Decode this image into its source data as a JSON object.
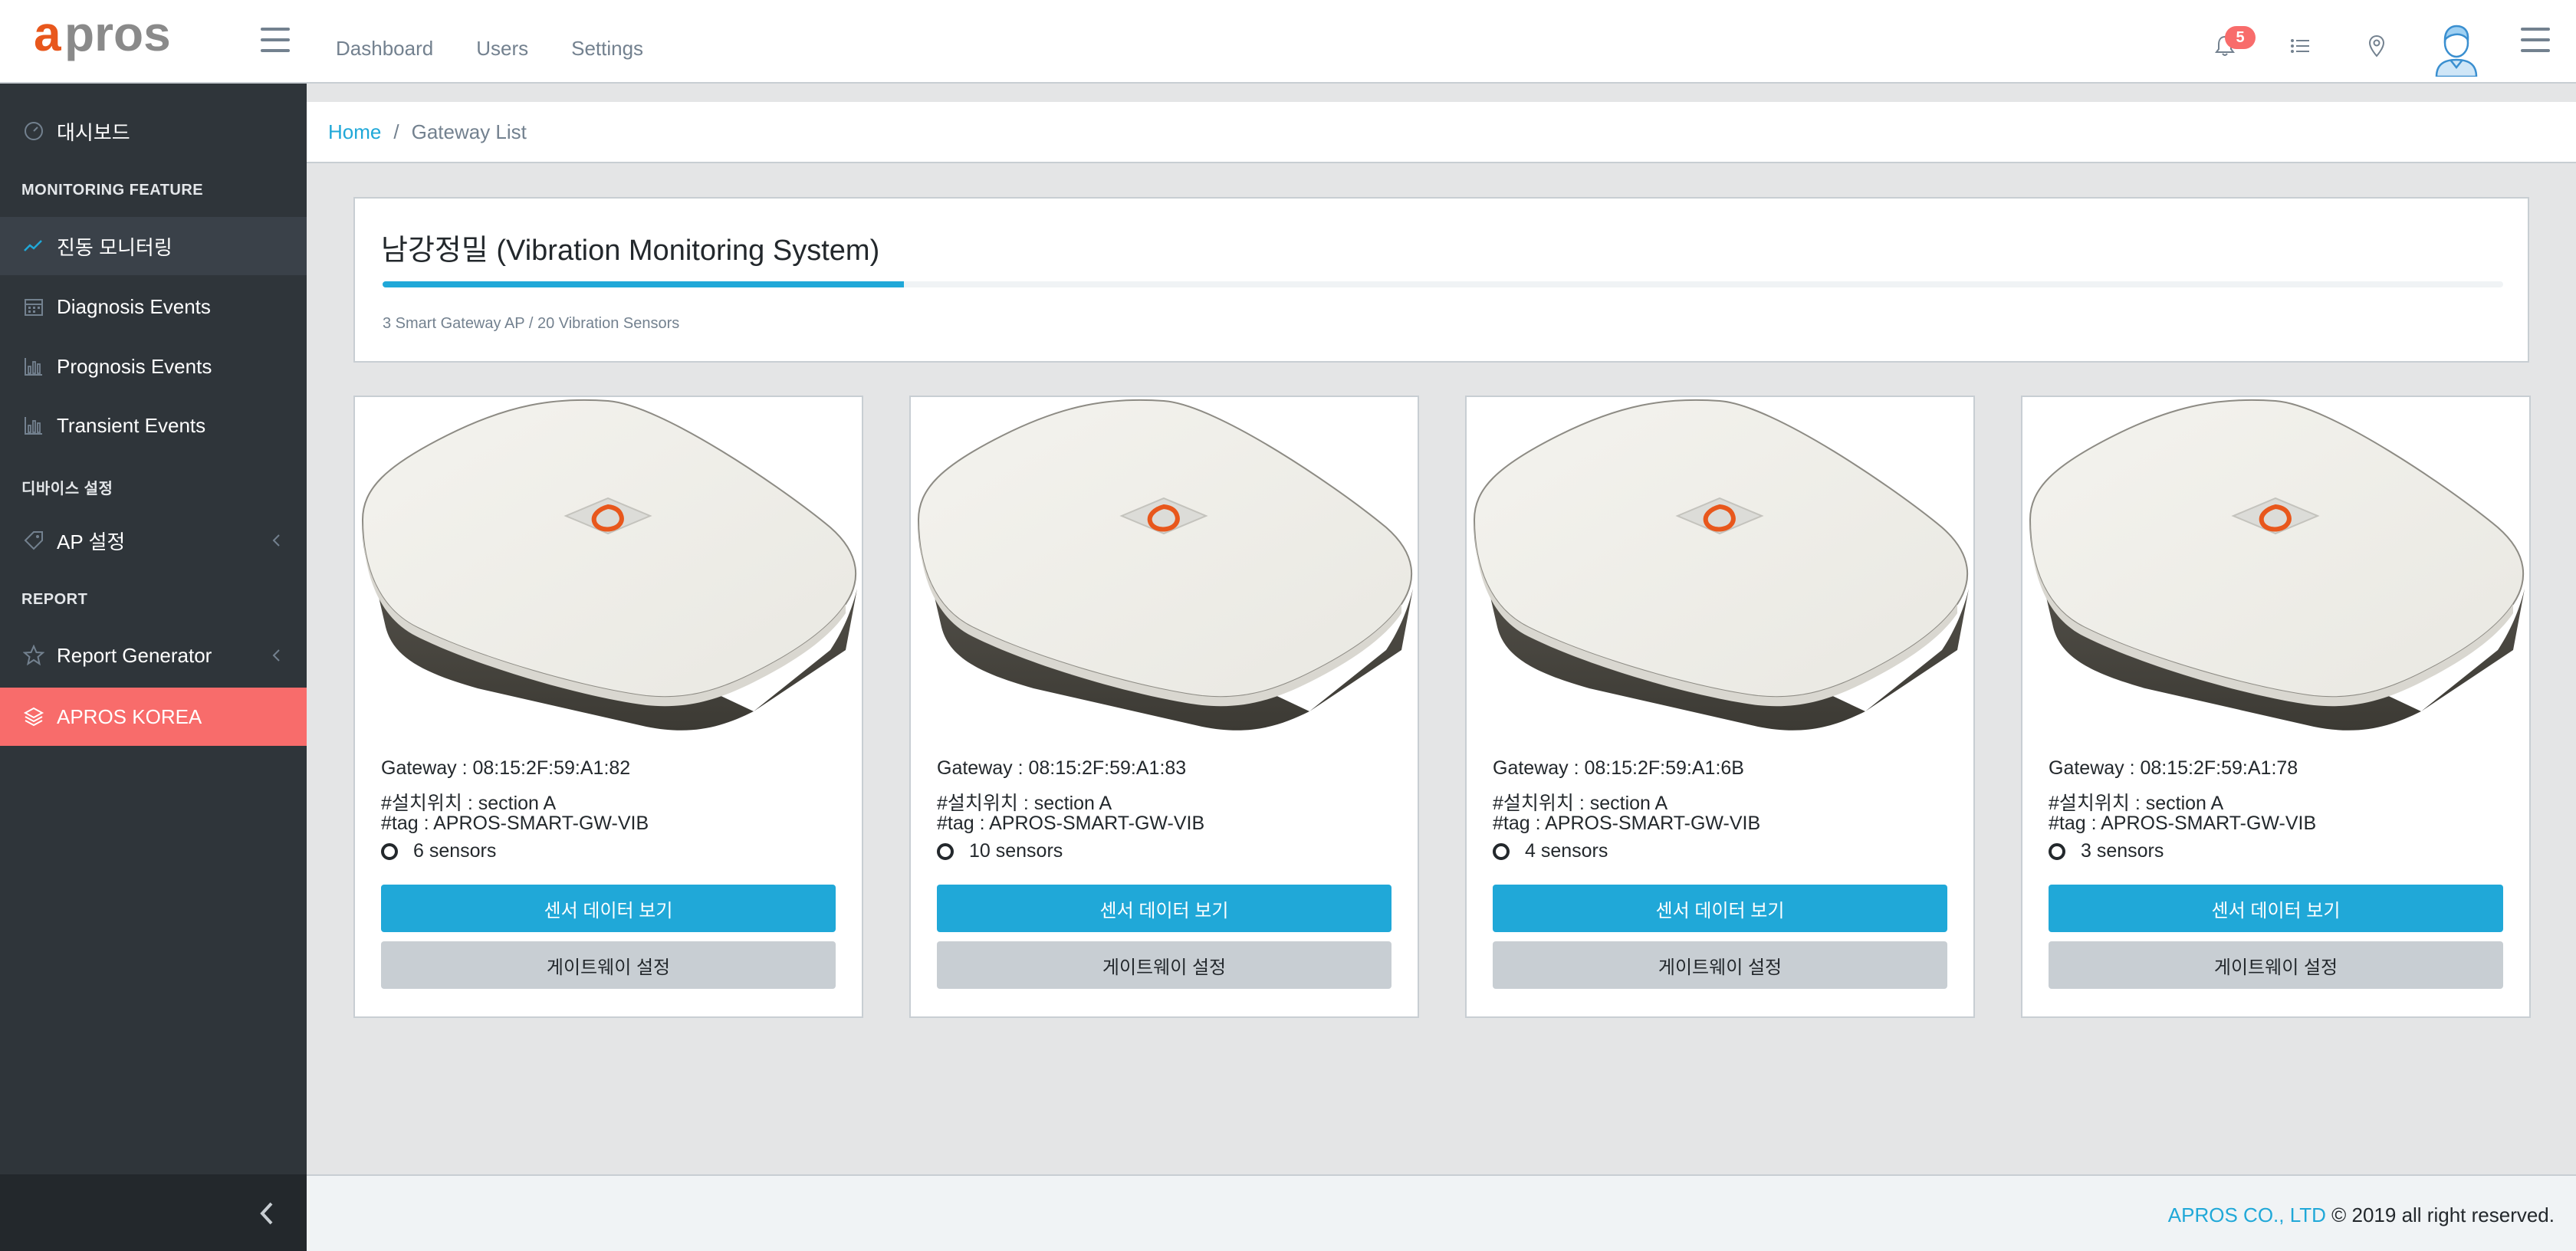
{
  "header": {
    "logo_text": "apros",
    "nav": [
      {
        "label": "Dashboard"
      },
      {
        "label": "Users"
      },
      {
        "label": "Settings"
      }
    ],
    "notification_count": "5",
    "icons": [
      "bell-icon",
      "list-icon",
      "location-pin-icon",
      "user-avatar",
      "menu-icon"
    ]
  },
  "sidebar": {
    "dashboard": "대시보드",
    "section_monitoring": "MONITORING FEATURE",
    "items_monitoring": [
      {
        "label": "진동 모니터링",
        "icon": "trend-icon"
      },
      {
        "label": "Diagnosis Events",
        "icon": "calendar-icon"
      },
      {
        "label": "Prognosis Events",
        "icon": "bar-chart-icon"
      },
      {
        "label": "Transient Events",
        "icon": "bar-chart-icon"
      }
    ],
    "section_device": "디바이스 설정",
    "ap_setting": "AP 설정",
    "section_report": "REPORT",
    "report_generator": "Report Generator",
    "company": "APROS KOREA"
  },
  "breadcrumb": {
    "home": "Home",
    "separator": "/",
    "current": "Gateway List"
  },
  "summary": {
    "title": "남강정밀 (Vibration Monitoring System)",
    "progress_percent": 24.6,
    "meta": "3 Smart Gateway AP / 20 Vibration Sensors"
  },
  "gateways": [
    {
      "id": "Gateway : 08:15:2F:59:A1:82",
      "location": "#설치위치 : section A",
      "tag": "#tag : APROS-SMART-GW-VIB",
      "sensors": "6 sensors",
      "btn_primary": "센서 데이터 보기",
      "btn_secondary": "게이트웨이 설정"
    },
    {
      "id": "Gateway : 08:15:2F:59:A1:83",
      "location": "#설치위치 : section A",
      "tag": "#tag : APROS-SMART-GW-VIB",
      "sensors": "10 sensors",
      "btn_primary": "센서 데이터 보기",
      "btn_secondary": "게이트웨이 설정"
    },
    {
      "id": "Gateway : 08:15:2F:59:A1:6B",
      "location": "#설치위치 : section A",
      "tag": "#tag : APROS-SMART-GW-VIB",
      "sensors": "4 sensors",
      "btn_primary": "센서 데이터 보기",
      "btn_secondary": "게이트웨이 설정"
    },
    {
      "id": "Gateway : 08:15:2F:59:A1:78",
      "location": "#설치위치 : section A",
      "tag": "#tag : APROS-SMART-GW-VIB",
      "sensors": "3 sensors",
      "btn_primary": "센서 데이터 보기",
      "btn_secondary": "게이트웨이 설정"
    }
  ],
  "footer": {
    "company": "APROS CO., LTD",
    "rights": " © 2019 all right reserved."
  },
  "colors": {
    "primary": "#20a8d8",
    "sidebar_bg": "#2f353a",
    "danger": "#f86c6b",
    "logo_orange": "#e8571c",
    "logo_gray": "#8a8a8a"
  }
}
